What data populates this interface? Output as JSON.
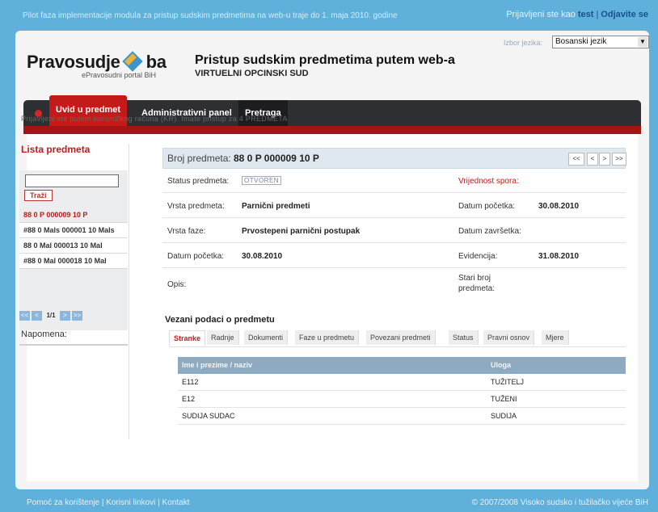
{
  "top": {
    "pilot": "Pilot faza implementacije modula za pristup sudskim predmetima na web-u traje do 1. maja 2010. godine",
    "login_prefix": "Prijavljeni ste kao",
    "user": "test",
    "sep": "|",
    "logout": "Odjavite se"
  },
  "header": {
    "logo_left": "Pravosudje",
    "logo_right": "ba",
    "logo_sub": "ePravosudni portal BiH",
    "title": "Pristup sudskim predmetima putem web-a",
    "subtitle": "VIRTUELNI OPCINSKI SUD",
    "lang_label": "Izbor jezika:",
    "lang_value": "Bosanski jezik"
  },
  "nav": {
    "tabs": [
      "Uvid u predmet",
      "Administrativni panel",
      "Pretraga"
    ]
  },
  "info": "Prijavljeni ste putem korisničkog računa (KR). Imate pristup za 4 PREDMETA",
  "sidebar": {
    "title": "Lista predmeta",
    "search_btn": "Traži",
    "items": [
      "88 0 P 000009 10 P",
      "#88 0 Mals 000001 10 Mals",
      "88 0 Mal 000013 10 Mal",
      "#88 0 Mal 000018 10 Mal"
    ],
    "pager": [
      "<<",
      "<",
      "1/1",
      ">",
      ">>"
    ],
    "note_label": "Napomena:"
  },
  "case": {
    "label": "Broj predmeta:",
    "number": "88 0 P 000009 10 P",
    "pager": [
      "<<",
      "<",
      ">",
      ">>"
    ],
    "rows": [
      {
        "l1": "Status predmeta:",
        "v1": "OTVOREN",
        "l2": "Vrijednost spora:",
        "v2": ""
      },
      {
        "l1": "Vrsta predmeta:",
        "v1": "Parnični predmeti",
        "l2": "Datum početka:",
        "v2": "30.08.2010"
      },
      {
        "l1": "Vrsta faze:",
        "v1": "Prvostepeni parnični postupak",
        "l2": "Datum završetka:",
        "v2": ""
      },
      {
        "l1": "Datum početka:",
        "v1": "30.08.2010",
        "l2": "Evidencija:",
        "v2": "31.08.2010"
      },
      {
        "l1": "Opis:",
        "v1": "",
        "l2": "Stari broj",
        "l2b": "predmeta:",
        "v2": ""
      }
    ]
  },
  "related": {
    "title": "Vezani podaci o predmetu",
    "tabs": [
      "Stranke",
      "Radnje",
      "Dokumenti",
      "Faze u predmetu",
      "Povezani predmeti",
      "Status",
      "Pravni osnov",
      "Mjere"
    ],
    "headers": [
      "Ime i prezime / naziv",
      "Uloga"
    ],
    "rows": [
      {
        "name": "E112",
        "role": "TUŽITELJ"
      },
      {
        "name": "E12",
        "role": "TUŽENI"
      },
      {
        "name": "SUDIJA SUDAC",
        "role": "SUDIJA"
      }
    ]
  },
  "footer": {
    "links": [
      "Pomoć za korištenje",
      "Korisni linkovi",
      "Kontakt"
    ],
    "copyright": "© 2007/2008 Visoko sudsko i tužilačko vijeće BiH"
  }
}
